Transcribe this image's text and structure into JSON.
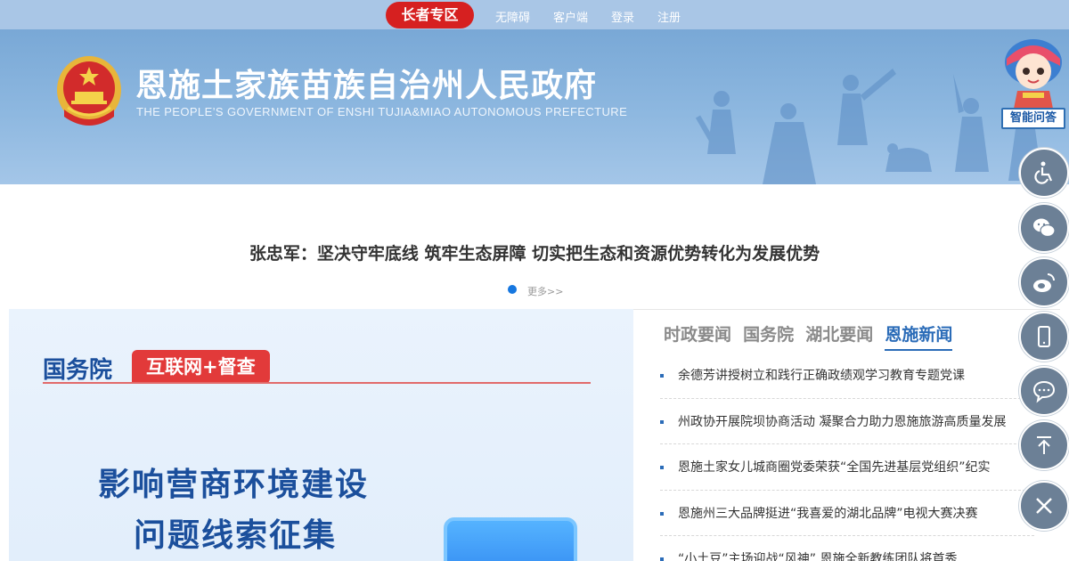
{
  "topbar": {
    "elder_label": "长者专区",
    "links": [
      "无障碍",
      "客户端",
      "登录",
      "注册"
    ]
  },
  "header": {
    "title": "恩施土家族苗族自治州人民政府",
    "subtitle": "THE PEOPLE’S GOVERNMENT OF ENSHI TUJIA&MIAO AUTONOMOUS PREFECTURE",
    "qa_label": "智能问答"
  },
  "headline": {
    "text": "张忠军：坚决守牢底线 筑牢生态屏障 切实把生态和资源优势转化为发展优势",
    "more_label": "更多>>"
  },
  "promo": {
    "org": "国务院",
    "tag": "互联网+督查",
    "line1": "影响营商环境建设",
    "line2": "问题线索征集"
  },
  "news": {
    "tabs": [
      "时政要闻",
      "国务院",
      "湖北要闻",
      "恩施新闻"
    ],
    "active_tab": 3,
    "items": [
      "余德芳讲授树立和践行正确政绩观学习教育专题党课",
      "州政协开展院坝协商活动 凝聚合力助力恩施旅游高质量发展",
      "恩施土家女儿城商圈党委荣获“全国先进基层党组织”纪实",
      "恩施州三大品牌挺进“我喜爱的湖北品牌”电视大赛决赛",
      "“小土豆”主场迎战“风神” 恩施全新教练团队将首秀"
    ]
  },
  "float_tools": [
    "accessibility-icon",
    "wechat-icon",
    "weibo-icon",
    "mobile-icon",
    "message-icon",
    "back-to-top-icon",
    "close-icon"
  ],
  "colors": {
    "elder_red": "#d62020",
    "banner_blue": "#79a8d6",
    "accent_blue": "#2b6cb8",
    "float_gray": "#6c8096"
  }
}
